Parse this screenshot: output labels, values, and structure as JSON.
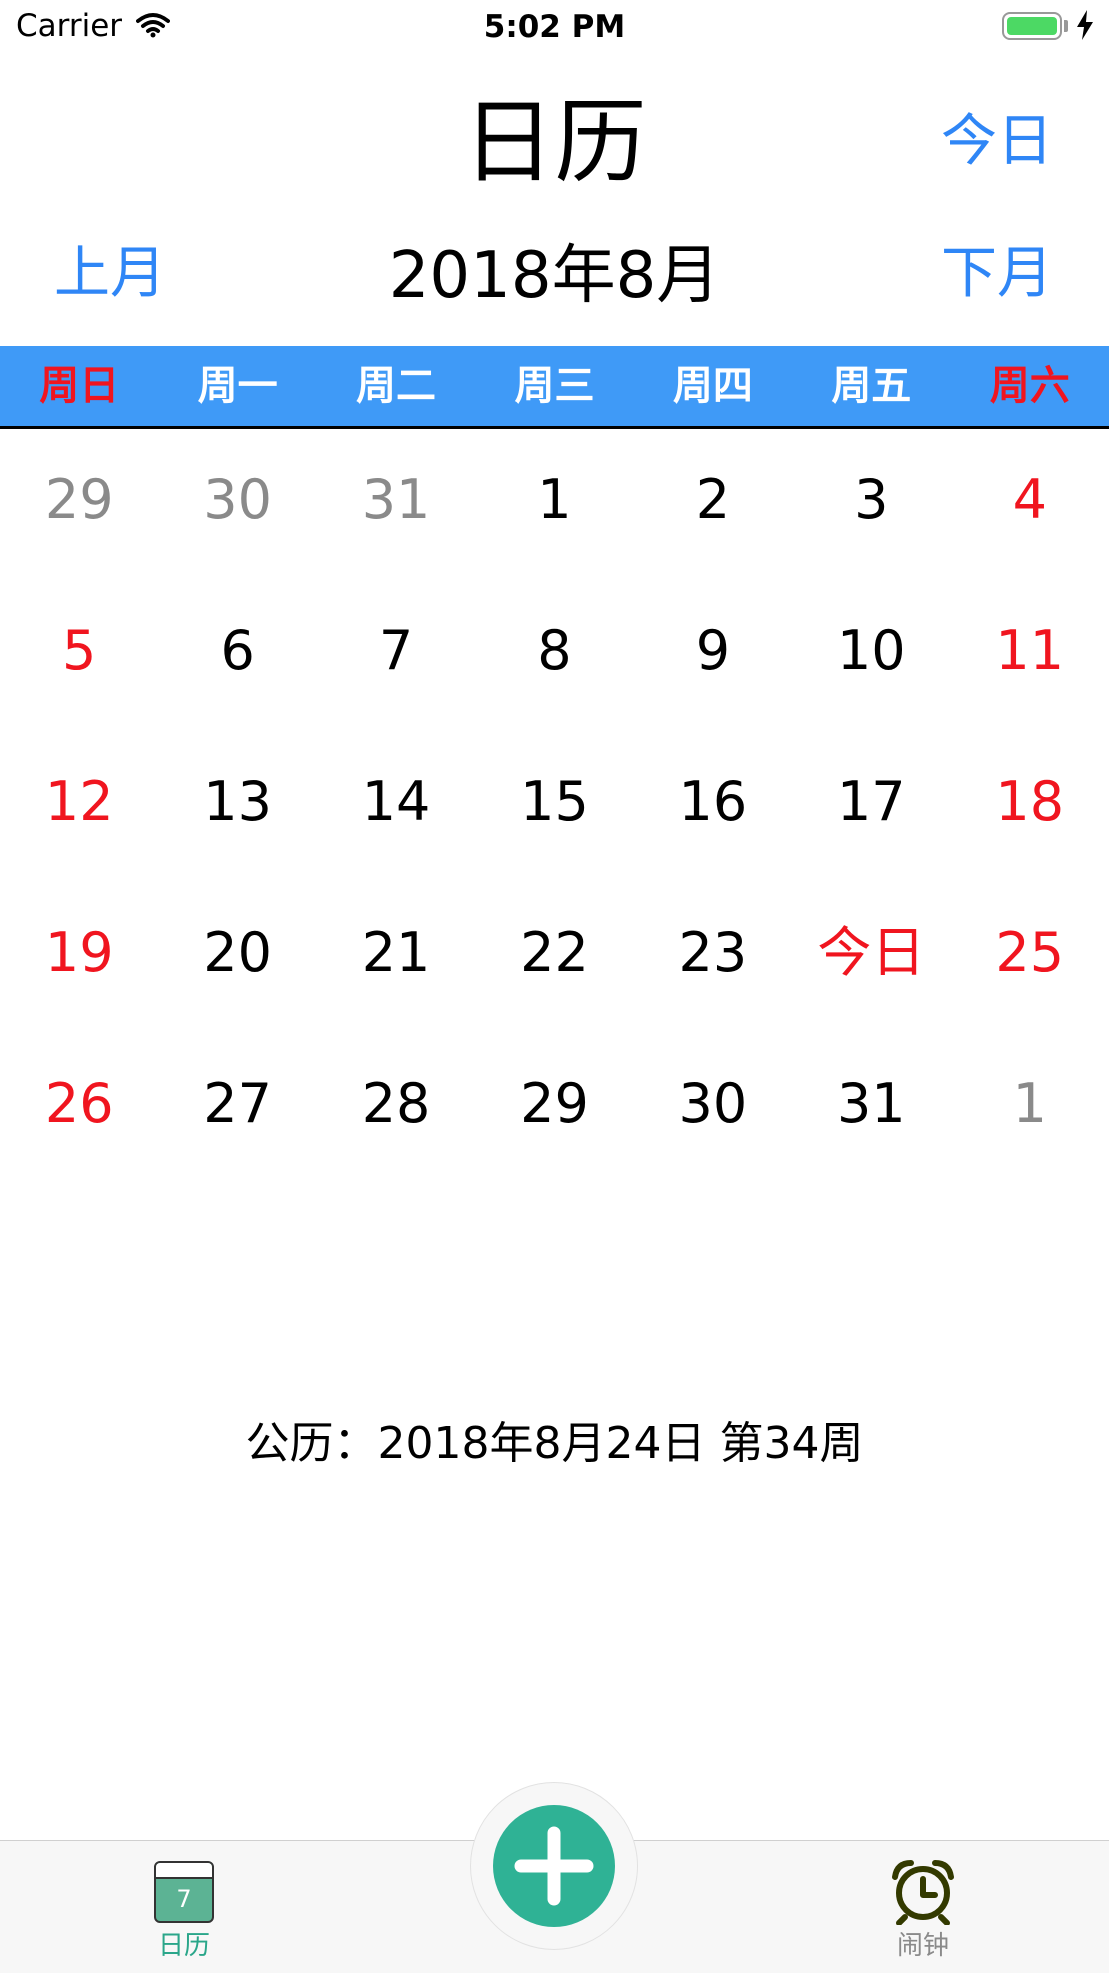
{
  "status_bar": {
    "carrier": "Carrier",
    "time": "5:02 PM"
  },
  "header": {
    "title": "日历",
    "today_button": "今日"
  },
  "month_nav": {
    "prev": "上月",
    "label": "2018年8月",
    "next": "下月"
  },
  "weekdays": [
    "周日",
    "周一",
    "周二",
    "周三",
    "周四",
    "周五",
    "周六"
  ],
  "weeks": [
    [
      {
        "text": "29",
        "type": "other"
      },
      {
        "text": "30",
        "type": "other"
      },
      {
        "text": "31",
        "type": "other"
      },
      {
        "text": "1",
        "type": "normal"
      },
      {
        "text": "2",
        "type": "normal"
      },
      {
        "text": "3",
        "type": "normal"
      },
      {
        "text": "4",
        "type": "weekend"
      }
    ],
    [
      {
        "text": "5",
        "type": "weekend"
      },
      {
        "text": "6",
        "type": "normal"
      },
      {
        "text": "7",
        "type": "normal"
      },
      {
        "text": "8",
        "type": "normal"
      },
      {
        "text": "9",
        "type": "normal"
      },
      {
        "text": "10",
        "type": "normal"
      },
      {
        "text": "11",
        "type": "weekend"
      }
    ],
    [
      {
        "text": "12",
        "type": "weekend"
      },
      {
        "text": "13",
        "type": "normal"
      },
      {
        "text": "14",
        "type": "normal"
      },
      {
        "text": "15",
        "type": "normal"
      },
      {
        "text": "16",
        "type": "normal"
      },
      {
        "text": "17",
        "type": "normal"
      },
      {
        "text": "18",
        "type": "weekend"
      }
    ],
    [
      {
        "text": "19",
        "type": "weekend"
      },
      {
        "text": "20",
        "type": "normal"
      },
      {
        "text": "21",
        "type": "normal"
      },
      {
        "text": "22",
        "type": "normal"
      },
      {
        "text": "23",
        "type": "normal"
      },
      {
        "text": "今日",
        "type": "today"
      },
      {
        "text": "25",
        "type": "weekend"
      }
    ],
    [
      {
        "text": "26",
        "type": "weekend"
      },
      {
        "text": "27",
        "type": "normal"
      },
      {
        "text": "28",
        "type": "normal"
      },
      {
        "text": "29",
        "type": "normal"
      },
      {
        "text": "30",
        "type": "normal"
      },
      {
        "text": "31",
        "type": "normal"
      },
      {
        "text": "1",
        "type": "other"
      }
    ]
  ],
  "info": "公历：2018年8月24日 第34周",
  "tab_bar": {
    "calendar": {
      "label": "日历",
      "icon": "calendar-icon",
      "icon_number": "7"
    },
    "add_icon": "plus-icon",
    "alarm": {
      "label": "闹钟",
      "icon": "alarm-clock-icon"
    }
  },
  "colors": {
    "accent_blue": "#2f86f6",
    "weekday_bar": "#3f9af7",
    "weekend_red": "#f0151f",
    "add_green": "#2fb295"
  }
}
